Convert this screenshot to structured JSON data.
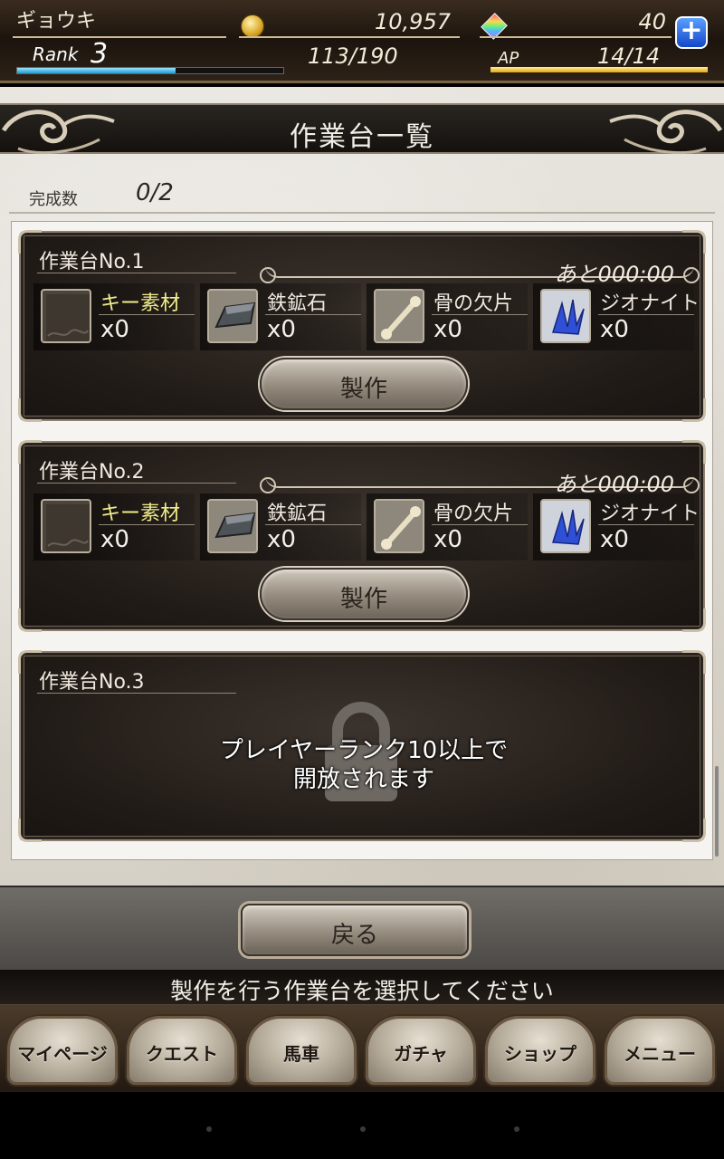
{
  "status": {
    "player_name": "ギョウキ",
    "gold": "10,957",
    "gems": "40",
    "plus": "+",
    "rank_label": "Rank",
    "rank_value": "3",
    "exp": "113/190",
    "exp_fraction": 0.595,
    "ap_label": "AP",
    "ap": "14/14",
    "ap_fraction": 1.0,
    "colors": {
      "exp_bar": "#1f9ad6",
      "ap_bar": "#e6a50c",
      "plus_button": "#1547c9"
    }
  },
  "header": {
    "title": "作業台一覧"
  },
  "summary": {
    "complete_label": "完成数",
    "complete_value": "0/2"
  },
  "benches": [
    {
      "title": "作業台No.1",
      "timer": "あと000:00",
      "make_label": "製作",
      "materials": [
        {
          "name": "キー素材",
          "count": "x0",
          "icon": "key-material-icon",
          "highlight": "#f1ec8a"
        },
        {
          "name": "鉄鉱石",
          "count": "x0",
          "icon": "iron-ore-icon"
        },
        {
          "name": "骨の欠片",
          "count": "x0",
          "icon": "bone-fragment-icon"
        },
        {
          "name": "ジオナイト",
          "count": "x0",
          "icon": "geonite-crystal-icon"
        }
      ]
    },
    {
      "title": "作業台No.2",
      "timer": "あと000:00",
      "make_label": "製作",
      "materials": [
        {
          "name": "キー素材",
          "count": "x0",
          "icon": "key-material-icon",
          "highlight": "#f1ec8a"
        },
        {
          "name": "鉄鉱石",
          "count": "x0",
          "icon": "iron-ore-icon"
        },
        {
          "name": "骨の欠片",
          "count": "x0",
          "icon": "bone-fragment-icon"
        },
        {
          "name": "ジオナイト",
          "count": "x0",
          "icon": "geonite-crystal-icon"
        }
      ]
    },
    {
      "title": "作業台No.3",
      "locked": true,
      "lock_line1": "プレイヤーランク10以上で",
      "lock_line2": "開放されます",
      "icon": "padlock-icon"
    }
  ],
  "back_button": "戻る",
  "message": "製作を行う作業台を選択してください",
  "nav": [
    "マイページ",
    "クエスト",
    "馬車",
    "ガチャ",
    "ショップ",
    "メニュー"
  ]
}
